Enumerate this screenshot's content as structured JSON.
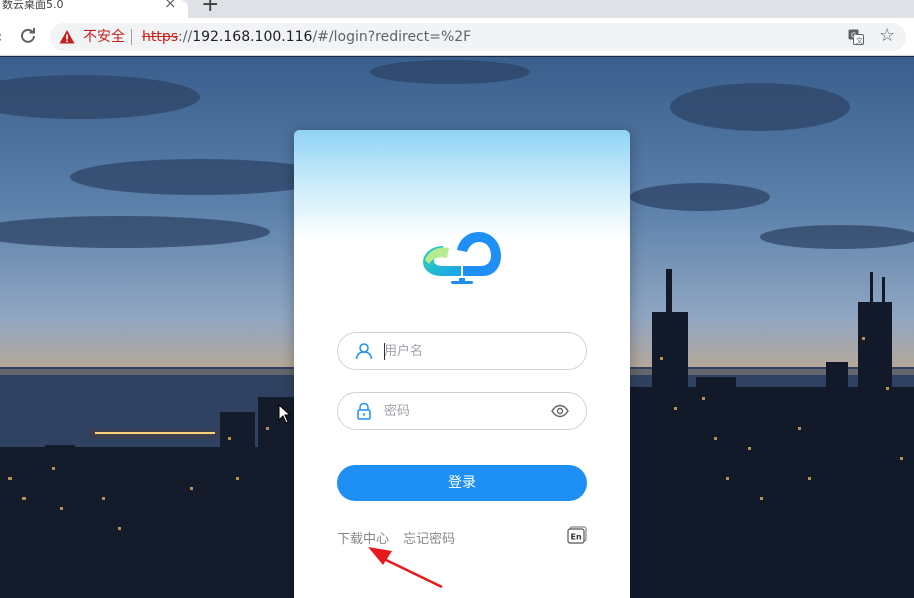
{
  "browser": {
    "tab_title": "数云桌面5.0",
    "tab_close": "×",
    "new_tab": "+",
    "security_label": "不安全",
    "url_scheme": "https",
    "url_sep": "://",
    "url_host": "192.168.100.116",
    "url_path": "/#/login?redirect=%2F",
    "back_icon": "‹",
    "star_icon": "☆"
  },
  "login": {
    "username_placeholder": "用户名",
    "password_placeholder": "密码",
    "submit_label": "登录",
    "links": [
      "下载中心",
      "忘记密码"
    ],
    "lang_label": "En"
  },
  "colors": {
    "primary": "#1e8ff5",
    "warning": "#c5221f",
    "annotation_arrow": "#e8191c"
  }
}
